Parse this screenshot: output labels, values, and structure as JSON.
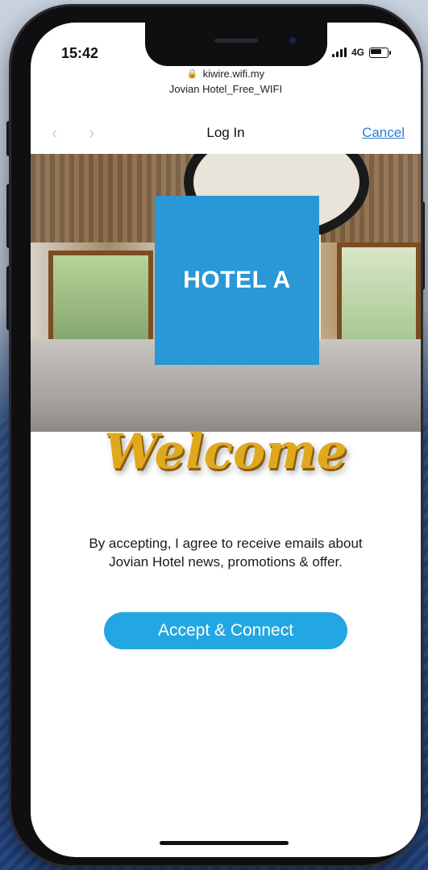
{
  "status_bar": {
    "time": "15:42",
    "network": "4G"
  },
  "browser": {
    "url": "kiwire.wifi.my",
    "ssid": "Jovian Hotel_Free_WIFI",
    "nav_title": "Log In",
    "cancel_label": "Cancel"
  },
  "hero": {
    "logo_text": "HOTEL A",
    "logo_color": "#2a97d6"
  },
  "content": {
    "welcome_text": "Welcome",
    "consent_text": "By accepting, I agree to receive emails about Jovian Hotel news, promotions & offer.",
    "accept_button_label": "Accept & Connect",
    "accent_color": "#23a7e3"
  },
  "icons": {
    "back": "chevron-left-icon",
    "forward": "chevron-right-icon",
    "lock": "lock-icon",
    "signal": "signal-icon",
    "battery": "battery-icon"
  }
}
